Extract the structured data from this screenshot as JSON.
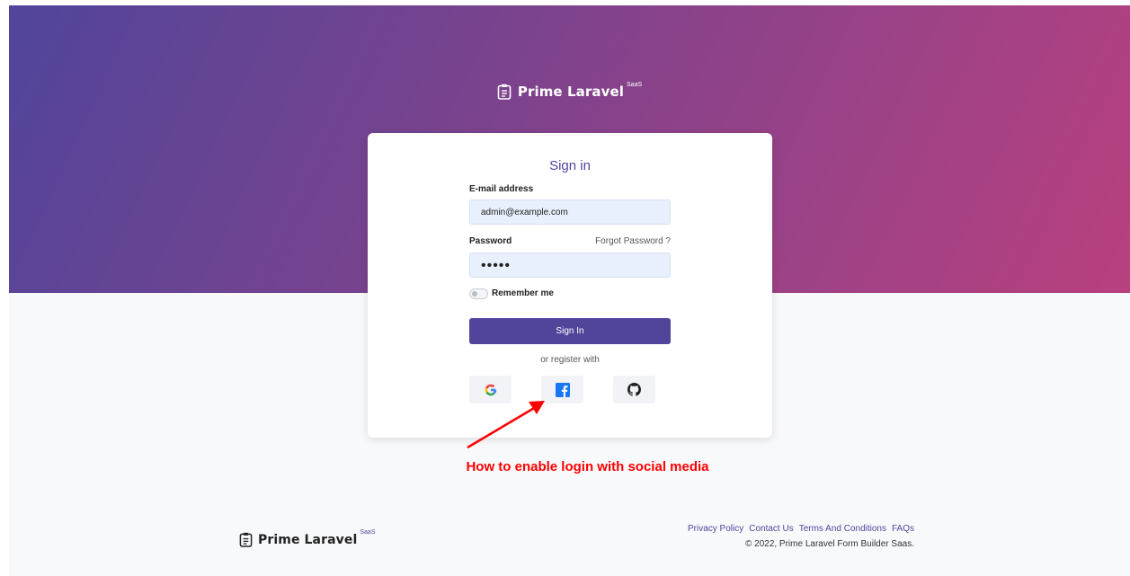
{
  "brand": {
    "name": "Prime Laravel",
    "badge": "SaaS"
  },
  "signin": {
    "title": "Sign in",
    "email_label": "E-mail address",
    "email_value": "admin@example.com",
    "password_label": "Password",
    "forgot_link": "Forgot Password ?",
    "password_mask": "•••••",
    "remember_label": "Remember me",
    "button_label": "Sign In",
    "or_register": "or register with"
  },
  "social": [
    "google-icon",
    "facebook-icon",
    "github-icon"
  ],
  "annotation": {
    "text": "How to enable login with social media",
    "color": "#ff0000"
  },
  "footer": {
    "links": [
      "Privacy Policy",
      "Contact Us",
      "Terms And Conditions",
      "FAQs"
    ],
    "copyright": "© 2022, Prime Laravel Form Builder Saas."
  },
  "colors": {
    "primary": "#51459b",
    "gradient_start": "#51459b",
    "gradient_end": "#b8407f"
  }
}
